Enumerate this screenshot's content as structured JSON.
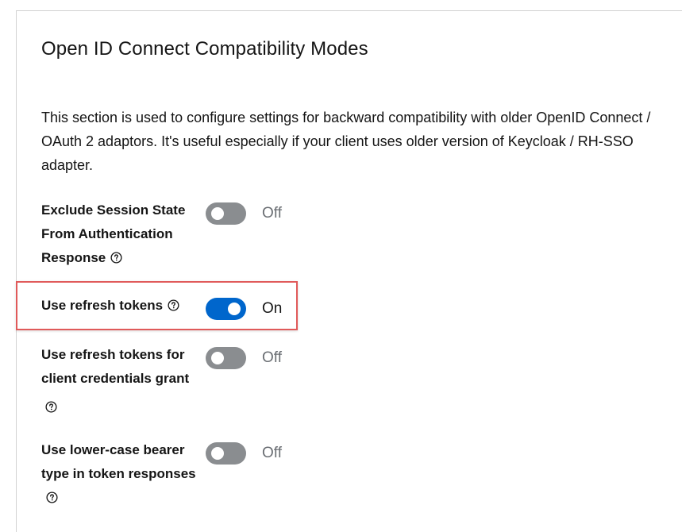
{
  "section": {
    "title": "Open ID Connect Compatibility Modes",
    "description": "This section is used to configure settings for backward compatibility with older OpenID Connect / OAuth 2 adaptors. It's useful especially if your client uses older version of Keycloak / RH-SSO adapter."
  },
  "settings": [
    {
      "label": "Exclude Session State From Authentication Response",
      "state_label": "Off",
      "enabled": false,
      "help_icon": "question-circle-icon"
    },
    {
      "label": "Use refresh tokens",
      "state_label": "On",
      "enabled": true,
      "help_icon": "question-circle-icon"
    },
    {
      "label": "Use refresh tokens for client credentials grant",
      "state_label": "Off",
      "enabled": false,
      "help_icon": "question-circle-icon"
    },
    {
      "label": "Use lower-case bearer type in token responses",
      "state_label": "Off",
      "enabled": false,
      "help_icon": "question-circle-icon"
    }
  ],
  "colors": {
    "switch_on": "#0066cc",
    "switch_off": "#8a8d90",
    "highlight": "#e05a5a"
  }
}
